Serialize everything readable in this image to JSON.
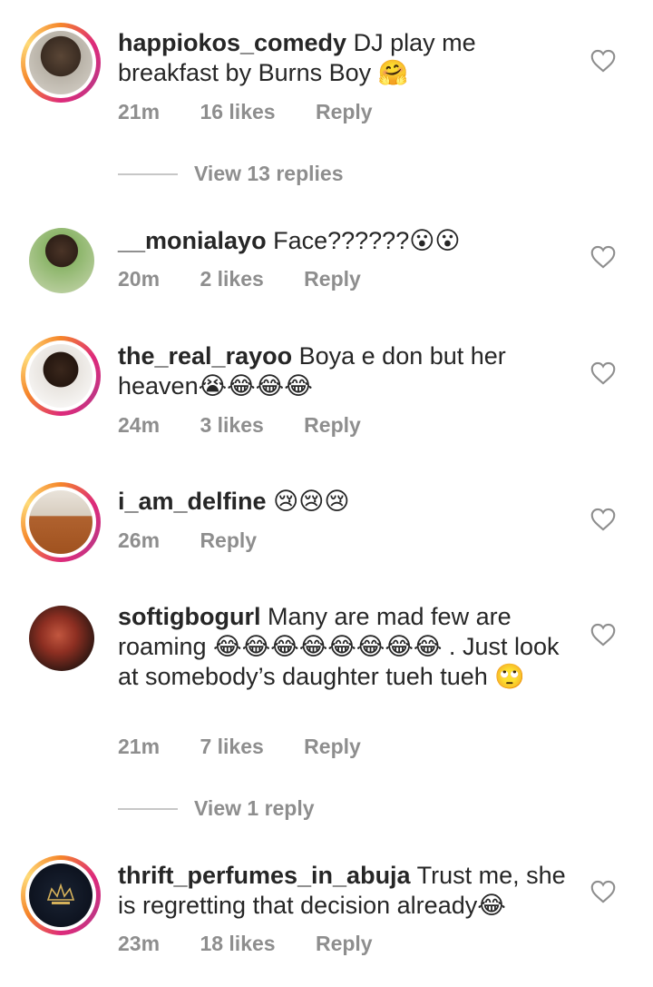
{
  "comments": [
    {
      "username": "happiokos_comedy",
      "text": "DJ play me breakfast by Burns Boy 🤗",
      "time": "21m",
      "likes": "16 likes",
      "reply": "Reply",
      "view_replies": "View 13 replies"
    },
    {
      "username": "__monialayo",
      "text": "Face??????😮😮",
      "time": "20m",
      "likes": "2 likes",
      "reply": "Reply"
    },
    {
      "username": "the_real_rayoo",
      "text": "Boya e don but her heaven😭😂😂😂",
      "time": "24m",
      "likes": "3 likes",
      "reply": "Reply"
    },
    {
      "username": "i_am_delfine",
      "text": "😢😢😢",
      "time": "26m",
      "likes": "",
      "reply": "Reply"
    },
    {
      "username": "softigbogurl",
      "text": "Many are mad few are roaming 😂😂😂😂😂😂😂😂 .  Just look at somebody’s daughter tueh tueh 🙄",
      "time": "21m",
      "likes": "7 likes",
      "reply": "Reply",
      "view_replies": "View 1 reply"
    },
    {
      "username": "thrift_perfumes_in_abuja",
      "text": "Trust me, she is regretting that decision already😂",
      "time": "23m",
      "likes": "18 likes",
      "reply": "Reply"
    }
  ],
  "icons": {
    "like": "heart-outline-icon"
  },
  "colors": {
    "ring_start": "#f58529",
    "ring_mid": "#dd2a7b",
    "ring_end": "#feda77",
    "muted": "#8e8e8e"
  }
}
